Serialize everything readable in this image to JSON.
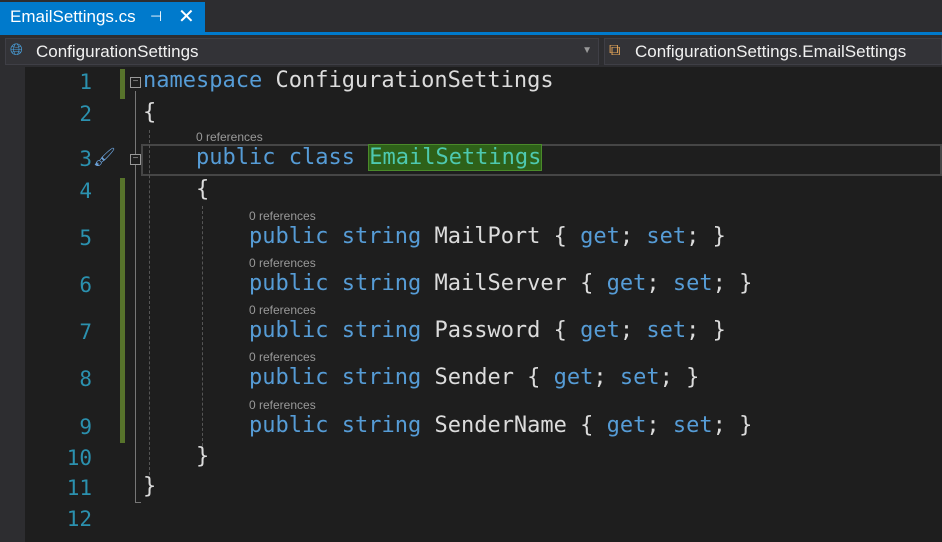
{
  "tab": {
    "title": "EmailSettings.cs",
    "pin_icon": "pin-icon",
    "close_icon": "close-icon"
  },
  "nav": {
    "project": "ConfigurationSettings",
    "member": "ConfigurationSettings.EmailSettings"
  },
  "references_label": "0 references",
  "lines": [
    {
      "n": "1",
      "indent": 0,
      "tokens": [
        {
          "t": "namespace",
          "k": "kw"
        },
        {
          "t": " ConfigurationSettings"
        }
      ]
    },
    {
      "n": "2",
      "indent": 0,
      "tokens": [
        {
          "t": "{"
        }
      ]
    },
    {
      "n": "3",
      "indent": 1,
      "ref": true,
      "tokens": [
        {
          "t": "public",
          "k": "kw"
        },
        {
          "t": " "
        },
        {
          "t": "class",
          "k": "kw"
        },
        {
          "t": " "
        },
        {
          "t": "EmailSettings",
          "k": "cls"
        }
      ]
    },
    {
      "n": "4",
      "indent": 1,
      "tokens": [
        {
          "t": "{"
        }
      ]
    },
    {
      "n": "5",
      "indent": 2,
      "ref": true,
      "tokens": [
        {
          "t": "public",
          "k": "kw"
        },
        {
          "t": " "
        },
        {
          "t": "string",
          "k": "kw"
        },
        {
          "t": " MailPort { "
        },
        {
          "t": "get",
          "k": "kw"
        },
        {
          "t": "; "
        },
        {
          "t": "set",
          "k": "kw"
        },
        {
          "t": "; }"
        }
      ]
    },
    {
      "n": "6",
      "indent": 2,
      "ref": true,
      "tokens": [
        {
          "t": "public",
          "k": "kw"
        },
        {
          "t": " "
        },
        {
          "t": "string",
          "k": "kw"
        },
        {
          "t": " MailServer { "
        },
        {
          "t": "get",
          "k": "kw"
        },
        {
          "t": "; "
        },
        {
          "t": "set",
          "k": "kw"
        },
        {
          "t": "; }"
        }
      ]
    },
    {
      "n": "7",
      "indent": 2,
      "ref": true,
      "tokens": [
        {
          "t": "public",
          "k": "kw"
        },
        {
          "t": " "
        },
        {
          "t": "string",
          "k": "kw"
        },
        {
          "t": " Password { "
        },
        {
          "t": "get",
          "k": "kw"
        },
        {
          "t": "; "
        },
        {
          "t": "set",
          "k": "kw"
        },
        {
          "t": "; }"
        }
      ]
    },
    {
      "n": "8",
      "indent": 2,
      "ref": true,
      "tokens": [
        {
          "t": "public",
          "k": "kw"
        },
        {
          "t": " "
        },
        {
          "t": "string",
          "k": "kw"
        },
        {
          "t": " Sender { "
        },
        {
          "t": "get",
          "k": "kw"
        },
        {
          "t": "; "
        },
        {
          "t": "set",
          "k": "kw"
        },
        {
          "t": "; }"
        }
      ]
    },
    {
      "n": "9",
      "indent": 2,
      "ref": true,
      "tokens": [
        {
          "t": "public",
          "k": "kw"
        },
        {
          "t": " "
        },
        {
          "t": "string",
          "k": "kw"
        },
        {
          "t": " SenderName { "
        },
        {
          "t": "get",
          "k": "kw"
        },
        {
          "t": "; "
        },
        {
          "t": "set",
          "k": "kw"
        },
        {
          "t": "; }"
        }
      ]
    },
    {
      "n": "10",
      "indent": 1,
      "tokens": [
        {
          "t": "}"
        }
      ]
    },
    {
      "n": "11",
      "indent": 0,
      "tokens": [
        {
          "t": "}"
        }
      ]
    },
    {
      "n": "12",
      "indent": 0,
      "tokens": []
    }
  ]
}
